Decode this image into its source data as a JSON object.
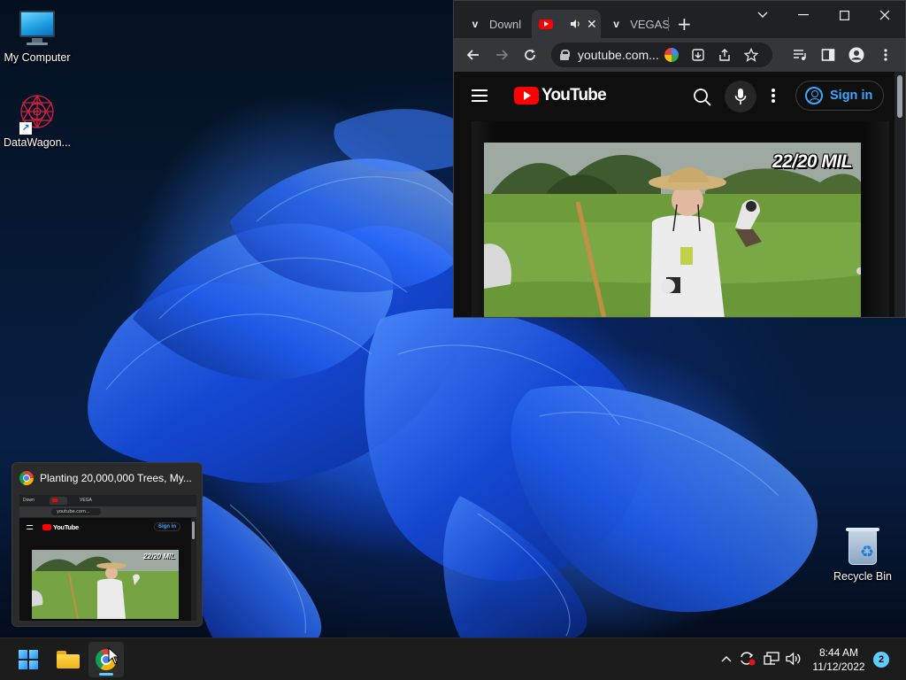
{
  "desktop": {
    "icons": [
      {
        "label": "My Computer",
        "icon": "computer-icon"
      },
      {
        "label": "DataWagon...",
        "icon": "datawagon-icon"
      },
      {
        "label": "Recycle Bin",
        "icon": "recycle-bin-icon"
      }
    ]
  },
  "chrome": {
    "tabs": [
      {
        "label": "Downl",
        "favicon": "v-icon",
        "active": false
      },
      {
        "label": "",
        "favicon": "youtube-icon",
        "active": true,
        "audio": "speaker-icon"
      },
      {
        "label": "VEGAS",
        "favicon": "v-icon",
        "active": false
      }
    ],
    "new_tab_symbol": "+",
    "window_controls": {
      "dropdown": "⌄",
      "minimize": "—",
      "maximize": "☐",
      "close": "✕"
    },
    "omnibox": {
      "url": "youtube.com..."
    },
    "page": {
      "logo_text": "YouTube",
      "sign_in": "Sign in",
      "video_overlay": "22/20 MIL"
    }
  },
  "preview": {
    "title": "Planting 20,000,000 Trees, My...",
    "mini": {
      "tab1": "Down",
      "tab3": "VEGA",
      "url": "youtube.com...",
      "logo_text": "YouTube",
      "sign_in": "Sign in",
      "video_overlay": "22/20 MIL"
    }
  },
  "taskbar": {
    "apps": [
      "start-button",
      "file-explorer",
      "chrome"
    ],
    "clock_time": "8:44 AM",
    "clock_date": "11/12/2022",
    "notification_count": "2"
  },
  "colors": {
    "accent": "#60cdff",
    "youtube_red": "#ff0000",
    "link_blue": "#3ea6ff"
  }
}
